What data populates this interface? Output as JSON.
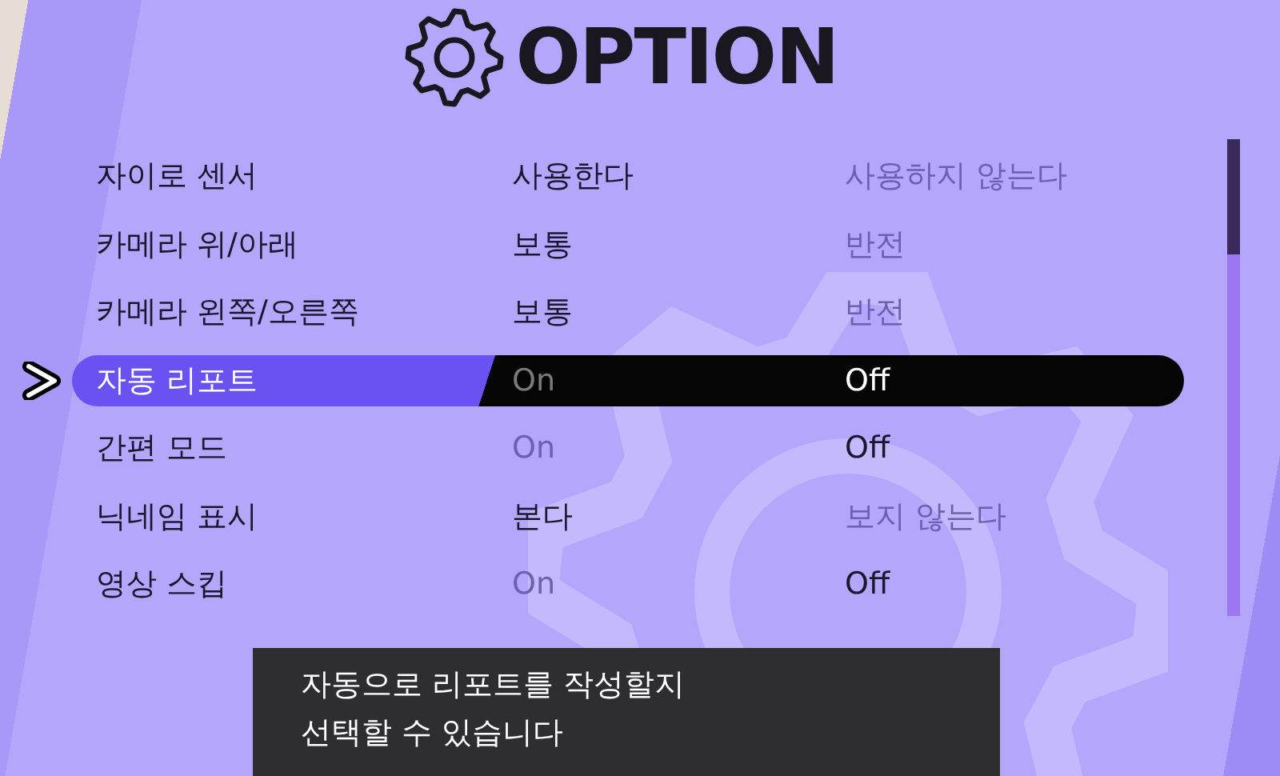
{
  "title": "OPTION",
  "rows": [
    {
      "label": "자이로 센서",
      "focused": false,
      "options": [
        {
          "label": "사용한다",
          "selected": true
        },
        {
          "label": "사용하지 않는다",
          "selected": false
        }
      ]
    },
    {
      "label": "카메라 위/아래",
      "focused": false,
      "options": [
        {
          "label": "보통",
          "selected": true
        },
        {
          "label": "반전",
          "selected": false
        }
      ]
    },
    {
      "label": "카메라 왼쪽/오른쪽",
      "focused": false,
      "options": [
        {
          "label": "보통",
          "selected": true
        },
        {
          "label": "반전",
          "selected": false
        }
      ]
    },
    {
      "label": "자동 리포트",
      "focused": true,
      "options": [
        {
          "label": "On",
          "selected": false
        },
        {
          "label": "Off",
          "selected": true
        }
      ]
    },
    {
      "label": "간편 모드",
      "focused": false,
      "options": [
        {
          "label": "On",
          "selected": false
        },
        {
          "label": "Off",
          "selected": true
        }
      ]
    },
    {
      "label": "닉네임 표시",
      "focused": false,
      "options": [
        {
          "label": "본다",
          "selected": true
        },
        {
          "label": "보지 않는다",
          "selected": false
        }
      ]
    },
    {
      "label": "영상 스킵",
      "focused": false,
      "options": [
        {
          "label": "On",
          "selected": false
        },
        {
          "label": "Off",
          "selected": true
        }
      ]
    }
  ],
  "description": [
    "자동으로 리포트를 작성할지",
    "선택할 수 있습니다"
  ]
}
